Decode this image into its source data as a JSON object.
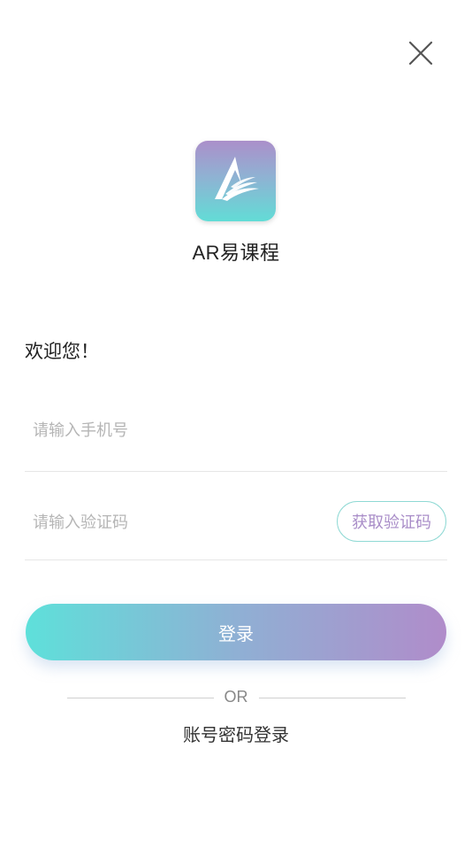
{
  "header": {
    "close_icon": "close-icon"
  },
  "app": {
    "logo_icon": "app-logo-icon",
    "name": "AR易课程"
  },
  "welcome_text": "欢迎您！",
  "form": {
    "phone_placeholder": "请输入手机号",
    "phone_value": "",
    "code_placeholder": "请输入验证码",
    "code_value": "",
    "get_code_label": "获取验证码",
    "login_label": "登录"
  },
  "divider_text": "OR",
  "alt_login_label": "账号密码登录",
  "colors": {
    "accent_teal": "#5ee0da",
    "accent_purple": "#b08cca",
    "placeholder": "#b5b5b5"
  }
}
